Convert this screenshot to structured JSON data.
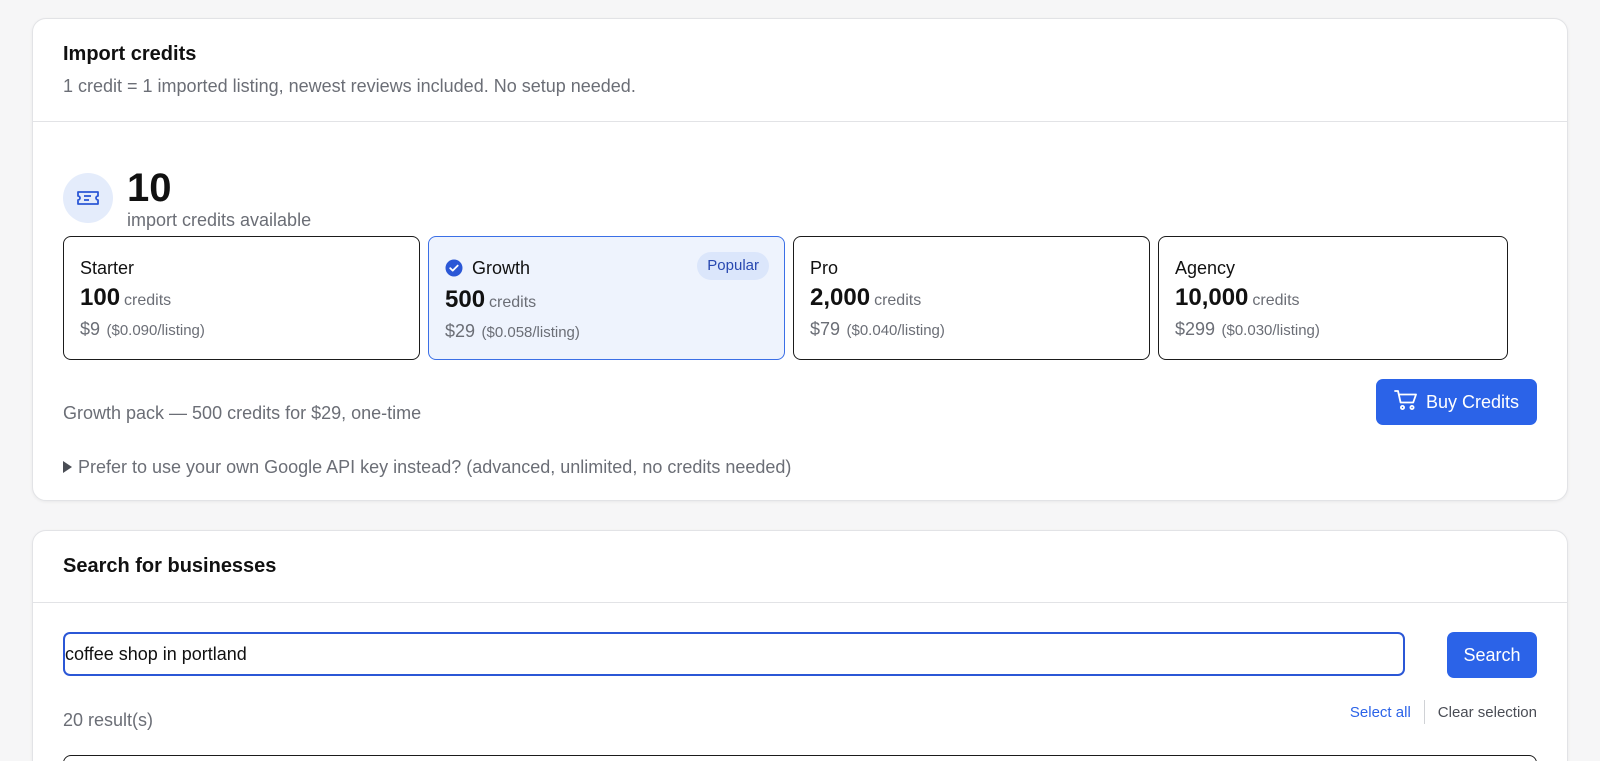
{
  "import_card": {
    "title": "Import credits",
    "subtitle": "1 credit = 1 imported listing, newest reviews included. No setup needed.",
    "balance": {
      "value": "10",
      "label": "import credits available",
      "icon": "ticket-icon"
    },
    "packs": [
      {
        "name": "Starter",
        "credits": "100",
        "credits_unit": "credits",
        "price": "$9",
        "per_listing": "($0.090/listing)",
        "selected": false
      },
      {
        "name": "Growth",
        "credits": "500",
        "credits_unit": "credits",
        "price": "$29",
        "per_listing": "($0.058/listing)",
        "selected": true,
        "badge": "Popular"
      },
      {
        "name": "Pro",
        "credits": "2,000",
        "credits_unit": "credits",
        "price": "$79",
        "per_listing": "($0.040/listing)",
        "selected": false
      },
      {
        "name": "Agency",
        "credits": "10,000",
        "credits_unit": "credits",
        "price": "$299",
        "per_listing": "($0.030/listing)",
        "selected": false
      }
    ],
    "summary": "Growth pack — 500 credits for $29, one-time",
    "buy_button": "Buy Credits",
    "advanced_toggle": "Prefer to use your own Google API key instead? (advanced, unlimited, no credits needed)"
  },
  "search_card": {
    "title": "Search for businesses",
    "search_value": "coffee shop in portland",
    "search_button": "Search",
    "results_count": "20 result(s)",
    "select_all": "Select all",
    "clear_selection": "Clear selection"
  },
  "colors": {
    "accent": "#2b63e8",
    "selected_bg": "#eef3fd",
    "badge_bg": "#dbe6fb",
    "muted_text": "#6b6e76"
  }
}
